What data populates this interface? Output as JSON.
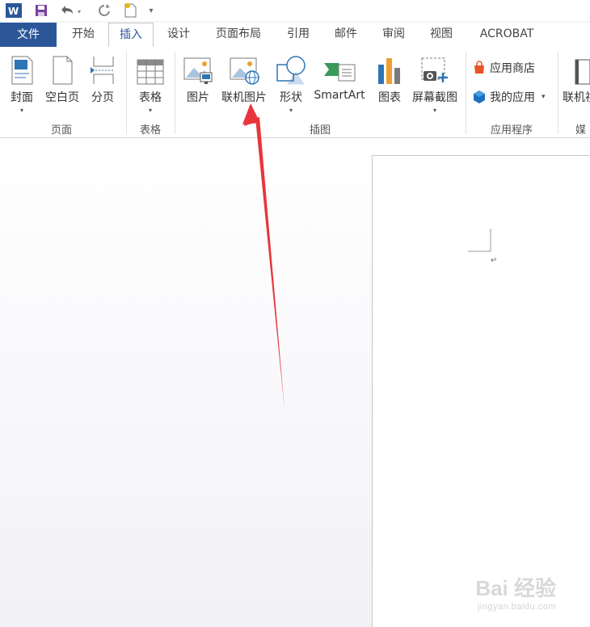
{
  "qat": {
    "app_logo": "W",
    "icons": [
      "word-logo-icon",
      "save-icon",
      "undo-icon",
      "redo-icon",
      "new-doc-icon",
      "customize-qat-icon"
    ]
  },
  "tabs": [
    {
      "label": "文件"
    },
    {
      "label": "开始"
    },
    {
      "label": "插入"
    },
    {
      "label": "设计"
    },
    {
      "label": "页面布局"
    },
    {
      "label": "引用"
    },
    {
      "label": "邮件"
    },
    {
      "label": "审阅"
    },
    {
      "label": "视图"
    },
    {
      "label": "ACROBAT"
    }
  ],
  "ribbon": {
    "pages": {
      "cover": "封面",
      "blank": "空白页",
      "break": "分页",
      "group": "页面"
    },
    "tables": {
      "table": "表格",
      "group": "表格"
    },
    "illustrations": {
      "picture": "图片",
      "online_picture": "联机图片",
      "shapes": "形状",
      "smartart": "SmartArt",
      "chart": "图表",
      "screenshot": "屏幕截图",
      "group": "插图"
    },
    "apps": {
      "store": "应用商店",
      "my_apps": "我的应用",
      "group": "应用程序"
    },
    "media": {
      "online_video": "联机视",
      "group": "媒"
    }
  },
  "document": {
    "paragraph_mark": "↵"
  },
  "watermark": {
    "brand": "Bai 经验",
    "sub": "jingyan.baidu.com"
  },
  "colors": {
    "file_tab": "#2b579a",
    "accent": "#2b579a",
    "arrow": "#e8353b",
    "store": "#e8532a",
    "myapps": "#1e6fc0"
  }
}
